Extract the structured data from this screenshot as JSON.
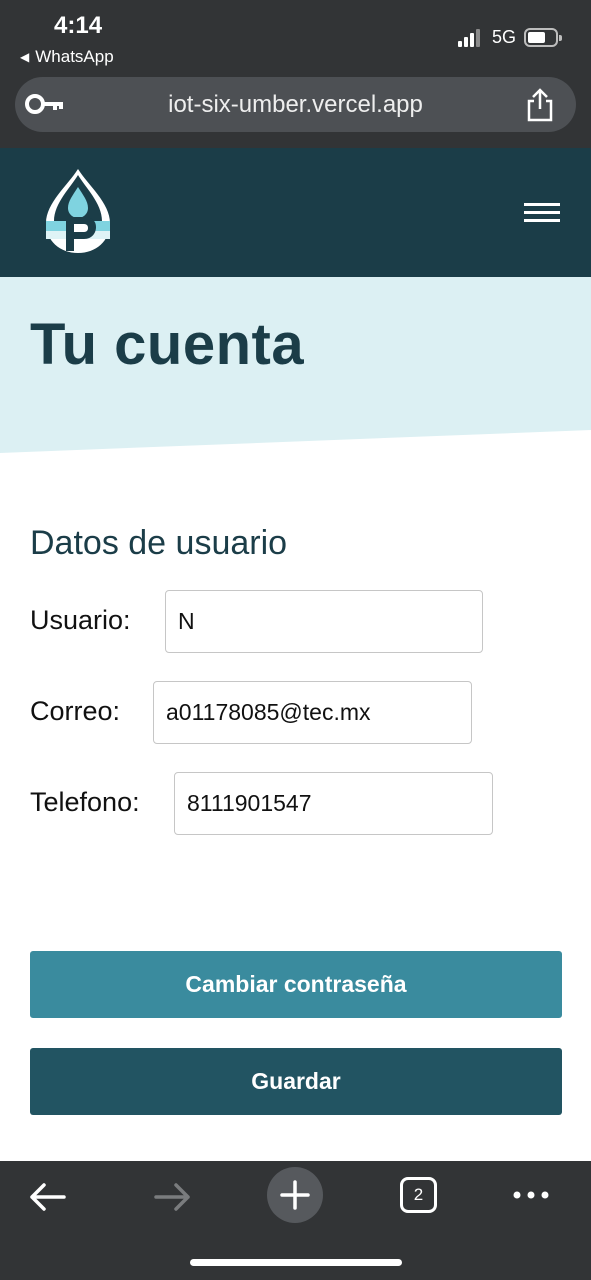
{
  "status_bar": {
    "time": "4:14",
    "back_app": "WhatsApp",
    "network": "5G"
  },
  "browser": {
    "url": "iot-six-umber.vercel.app",
    "tabs_count": "2"
  },
  "site": {
    "header_bg": "#1b3d48",
    "hero_title": "Tu cuenta"
  },
  "form": {
    "section_title": "Datos de usuario",
    "usuario_label": "Usuario:",
    "usuario_value": "N",
    "correo_label": "Correo:",
    "correo_value": "a01178085@tec.mx",
    "telefono_label": "Telefono:",
    "telefono_value": "8111901547"
  },
  "buttons": {
    "change_password": "Cambiar contraseña",
    "save": "Guardar"
  },
  "colors": {
    "accent": "#3a8b9e",
    "primary": "#225462",
    "hero_bg": "#dcf0f3"
  }
}
